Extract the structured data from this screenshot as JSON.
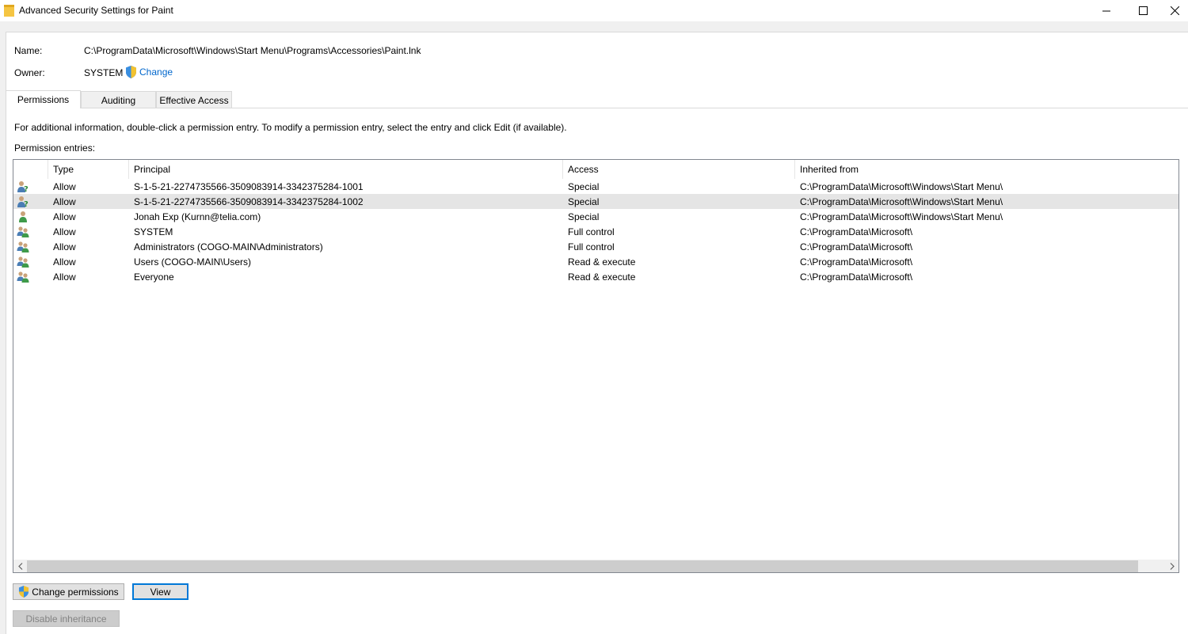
{
  "window": {
    "title": "Advanced Security Settings for Paint"
  },
  "fields": {
    "name_label": "Name:",
    "name_value": "C:\\ProgramData\\Microsoft\\Windows\\Start Menu\\Programs\\Accessories\\Paint.lnk",
    "owner_label": "Owner:",
    "owner_value": "SYSTEM",
    "change_link": "Change"
  },
  "tabs": [
    {
      "label": "Permissions",
      "active": true
    },
    {
      "label": "Auditing",
      "active": false
    },
    {
      "label": "Effective Access",
      "active": false
    }
  ],
  "permissions": {
    "info_text": "For additional information, double-click a permission entry. To modify a permission entry, select the entry and click Edit (if available).",
    "entries_label": "Permission entries:",
    "columns": [
      "Type",
      "Principal",
      "Access",
      "Inherited from"
    ],
    "rows": [
      {
        "icon": "unknown-user-icon",
        "type": "Allow",
        "principal": "S-1-5-21-2274735566-3509083914-3342375284-1001",
        "access": "Special",
        "inherited": "C:\\ProgramData\\Microsoft\\Windows\\Start Menu\\"
      },
      {
        "icon": "unknown-user-icon",
        "type": "Allow",
        "principal": "S-1-5-21-2274735566-3509083914-3342375284-1002",
        "access": "Special",
        "inherited": "C:\\ProgramData\\Microsoft\\Windows\\Start Menu\\",
        "selected": true
      },
      {
        "icon": "user-icon",
        "type": "Allow",
        "principal": "Jonah Exp (Kurnn@telia.com)",
        "access": "Special",
        "inherited": "C:\\ProgramData\\Microsoft\\Windows\\Start Menu\\"
      },
      {
        "icon": "group-icon",
        "type": "Allow",
        "principal": "SYSTEM",
        "access": "Full control",
        "inherited": "C:\\ProgramData\\Microsoft\\"
      },
      {
        "icon": "group-icon",
        "type": "Allow",
        "principal": "Administrators (COGO-MAIN\\Administrators)",
        "access": "Full control",
        "inherited": "C:\\ProgramData\\Microsoft\\"
      },
      {
        "icon": "group-icon",
        "type": "Allow",
        "principal": "Users (COGO-MAIN\\Users)",
        "access": "Read & execute",
        "inherited": "C:\\ProgramData\\Microsoft\\"
      },
      {
        "icon": "group-icon",
        "type": "Allow",
        "principal": "Everyone",
        "access": "Read & execute",
        "inherited": "C:\\ProgramData\\Microsoft\\"
      }
    ]
  },
  "buttons": {
    "change_permissions": "Change permissions",
    "view": "View",
    "disable_inheritance": "Disable inheritance"
  },
  "colors": {
    "link": "#0066cc",
    "focus_border": "#0078d7",
    "selected_row": "#e5e5e5",
    "dialog_bg": "#f0f0f0"
  }
}
